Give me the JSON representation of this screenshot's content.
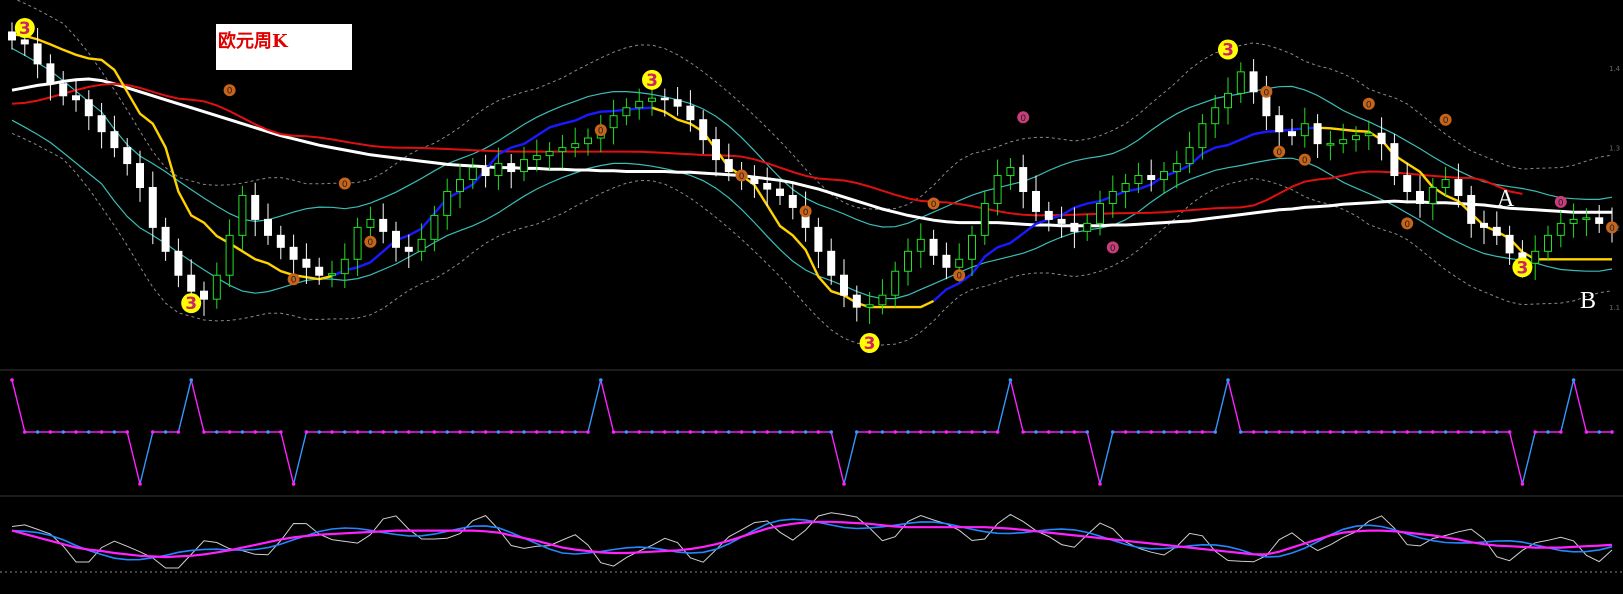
{
  "title": "欧元周K",
  "annotations": {
    "A": "A",
    "B": "B"
  },
  "marker_text": {
    "big": "3",
    "small": "0"
  },
  "colors": {
    "background": "#000000",
    "up_candle": "#22e022",
    "down_candle": "#ffffff",
    "white_ma": "#ffffff",
    "fast_ma_down": "#ffd200",
    "fast_ma_up": "#1a1aff",
    "red_ma": "#e01010",
    "cyan_band": "#3bbdb6",
    "envelope": "#8a8a8a",
    "marker_big_fill": "#ffff00",
    "marker_big_text": "#cc2266",
    "marker_small_fill": "#c8641a",
    "marker_pink_fill": "#c83c78",
    "osc_up": "#3399ff",
    "osc_down": "#ff22ff",
    "stoch_white": "#cfcfcf",
    "stoch_blue": "#2288ff",
    "stoch_magenta": "#ff22ff"
  },
  "chart_data": [
    {
      "type": "candlestick",
      "panel": "price",
      "n": 126,
      "close": [
        1.435,
        1.43,
        1.405,
        1.38,
        1.365,
        1.36,
        1.34,
        1.32,
        1.3,
        1.28,
        1.25,
        1.2,
        1.17,
        1.14,
        1.12,
        1.11,
        1.14,
        1.19,
        1.24,
        1.21,
        1.19,
        1.175,
        1.16,
        1.15,
        1.14,
        1.142,
        1.16,
        1.2,
        1.21,
        1.195,
        1.175,
        1.17,
        1.185,
        1.215,
        1.245,
        1.26,
        1.275,
        1.265,
        1.28,
        1.27,
        1.285,
        1.29,
        1.295,
        1.3,
        1.305,
        1.312,
        1.325,
        1.34,
        1.35,
        1.358,
        1.362,
        1.36,
        1.352,
        1.335,
        1.31,
        1.285,
        1.27,
        1.262,
        1.255,
        1.248,
        1.24,
        1.225,
        1.2,
        1.17,
        1.14,
        1.115,
        1.1,
        1.103,
        1.115,
        1.145,
        1.17,
        1.185,
        1.165,
        1.15,
        1.16,
        1.19,
        1.23,
        1.265,
        1.275,
        1.245,
        1.22,
        1.21,
        1.205,
        1.195,
        1.205,
        1.23,
        1.245,
        1.255,
        1.265,
        1.26,
        1.27,
        1.28,
        1.3,
        1.33,
        1.35,
        1.368,
        1.395,
        1.37,
        1.34,
        1.32,
        1.315,
        1.33,
        1.305,
        1.305,
        1.31,
        1.315,
        1.318,
        1.305,
        1.265,
        1.245,
        1.23,
        1.25,
        1.26,
        1.24,
        1.205,
        1.2,
        1.19,
        1.168,
        1.155,
        1.17,
        1.19,
        1.205,
        1.21,
        1.212,
        1.205,
        1.196
      ],
      "ma_slow": [
        1.372,
        1.375,
        1.378,
        1.38,
        1.383,
        1.385,
        1.386,
        1.384,
        1.38,
        1.375,
        1.37,
        1.365,
        1.36,
        1.355,
        1.35,
        1.345,
        1.34,
        1.335,
        1.33,
        1.325,
        1.32,
        1.315,
        1.311,
        1.307,
        1.303,
        1.3,
        1.297,
        1.294,
        1.291,
        1.289,
        1.287,
        1.285,
        1.283,
        1.281,
        1.279,
        1.278,
        1.277,
        1.276,
        1.275,
        1.275,
        1.274,
        1.274,
        1.273,
        1.273,
        1.272,
        1.272,
        1.271,
        1.271,
        1.27,
        1.27,
        1.27,
        1.27,
        1.269,
        1.269,
        1.268,
        1.267,
        1.266,
        1.265,
        1.263,
        1.261,
        1.259,
        1.256,
        1.252,
        1.248,
        1.243,
        1.238,
        1.233,
        1.228,
        1.223,
        1.219,
        1.215,
        1.212,
        1.209,
        1.207,
        1.206,
        1.206,
        1.206,
        1.206,
        1.205,
        1.204,
        1.203,
        1.203,
        1.202,
        1.202,
        1.202,
        1.202,
        1.203,
        1.203,
        1.204,
        1.205,
        1.206,
        1.207,
        1.208,
        1.21,
        1.212,
        1.214,
        1.216,
        1.218,
        1.22,
        1.222,
        1.223,
        1.225,
        1.226,
        1.227,
        1.229,
        1.23,
        1.231,
        1.232,
        1.233,
        1.232,
        1.232,
        1.231,
        1.231,
        1.23,
        1.229,
        1.228,
        1.226,
        1.224,
        1.223,
        1.222,
        1.221,
        1.22,
        1.219,
        1.219,
        1.219,
        1.219
      ],
      "ytick_labels": [
        "1.4",
        "1.3",
        "1.2",
        "1.1"
      ],
      "fast_ma_knots": [
        [
          0,
          1.442
        ],
        [
          7,
          1.41
        ],
        [
          11,
          1.33
        ],
        [
          14,
          1.215
        ],
        [
          17,
          1.18
        ],
        [
          19,
          1.16
        ],
        [
          22,
          1.14
        ],
        [
          24,
          1.135
        ],
        [
          27,
          1.15
        ],
        [
          31,
          1.19
        ],
        [
          35,
          1.245
        ],
        [
          39,
          1.3
        ],
        [
          43,
          1.33
        ],
        [
          46,
          1.345
        ],
        [
          50,
          1.35
        ],
        [
          53,
          1.33
        ],
        [
          57,
          1.265
        ],
        [
          61,
          1.19
        ],
        [
          64,
          1.12
        ],
        [
          67,
          1.1
        ],
        [
          71,
          1.1
        ],
        [
          74,
          1.13
        ],
        [
          77,
          1.175
        ],
        [
          81,
          1.21
        ],
        [
          84,
          1.23
        ],
        [
          88,
          1.248
        ],
        [
          91,
          1.27
        ],
        [
          94,
          1.3
        ],
        [
          98,
          1.32
        ],
        [
          102,
          1.325
        ],
        [
          106,
          1.32
        ],
        [
          109,
          1.28
        ],
        [
          112,
          1.24
        ],
        [
          116,
          1.195
        ],
        [
          119,
          1.16
        ],
        [
          123,
          1.16
        ],
        [
          125,
          1.16
        ]
      ],
      "fast_ma_down_ranges": [
        [
          0,
          24
        ],
        [
          50,
          71
        ],
        [
          102,
          125
        ]
      ],
      "red_ma_knots": [
        [
          0,
          1.355
        ],
        [
          8,
          1.38
        ],
        [
          14,
          1.36
        ],
        [
          22,
          1.315
        ],
        [
          30,
          1.3
        ],
        [
          40,
          1.295
        ],
        [
          48,
          1.295
        ],
        [
          56,
          1.29
        ],
        [
          64,
          1.26
        ],
        [
          72,
          1.232
        ],
        [
          80,
          1.215
        ],
        [
          88,
          1.218
        ],
        [
          96,
          1.225
        ],
        [
          102,
          1.26
        ],
        [
          106,
          1.27
        ],
        [
          114,
          1.262
        ],
        [
          118,
          1.242
        ]
      ],
      "big_markers": [
        {
          "i": 1,
          "y": 1.45
        },
        {
          "i": 14,
          "y": 1.105
        },
        {
          "i": 50,
          "y": 1.385
        },
        {
          "i": 67,
          "y": 1.055
        },
        {
          "i": 95,
          "y": 1.423
        },
        {
          "i": 118,
          "y": 1.15
        }
      ],
      "small_markers": [
        {
          "i": 17,
          "y": 1.372,
          "c": "o"
        },
        {
          "i": 22,
          "y": 1.135,
          "c": "o"
        },
        {
          "i": 26,
          "y": 1.255,
          "c": "o"
        },
        {
          "i": 28,
          "y": 1.182,
          "c": "o"
        },
        {
          "i": 46,
          "y": 1.322,
          "c": "o"
        },
        {
          "i": 57,
          "y": 1.265,
          "c": "o"
        },
        {
          "i": 62,
          "y": 1.22,
          "c": "o"
        },
        {
          "i": 72,
          "y": 1.23,
          "c": "o"
        },
        {
          "i": 74,
          "y": 1.14,
          "c": "o"
        },
        {
          "i": 79,
          "y": 1.338,
          "c": "p"
        },
        {
          "i": 86,
          "y": 1.175,
          "c": "p"
        },
        {
          "i": 98,
          "y": 1.37,
          "c": "o"
        },
        {
          "i": 99,
          "y": 1.295,
          "c": "o"
        },
        {
          "i": 101,
          "y": 1.285,
          "c": "o"
        },
        {
          "i": 106,
          "y": 1.355,
          "c": "o"
        },
        {
          "i": 109,
          "y": 1.205,
          "c": "o"
        },
        {
          "i": 112,
          "y": 1.335,
          "c": "o"
        },
        {
          "i": 121,
          "y": 1.232,
          "c": "p"
        },
        {
          "i": 125,
          "y": 1.2,
          "c": "o"
        }
      ]
    },
    {
      "type": "line",
      "panel": "oscillator",
      "pattern": [
        "flat-neg",
        "flat-pos"
      ],
      "ylim": [
        -1,
        1
      ],
      "peaks": [
        0,
        14,
        46,
        78,
        95,
        122
      ],
      "troughs": [
        10,
        22,
        65,
        85,
        118
      ]
    },
    {
      "type": "line",
      "panel": "stochastic",
      "series": [
        "white",
        "blue",
        "magenta"
      ],
      "ylim": [
        0,
        100
      ],
      "magenta": [
        55,
        50,
        45,
        40,
        35,
        30,
        27,
        25,
        22,
        20,
        18,
        17,
        16,
        17,
        18,
        20,
        23,
        26,
        30,
        34,
        38,
        42,
        45,
        47,
        49,
        50,
        51,
        52,
        53,
        54,
        55,
        55,
        55,
        55,
        55,
        55,
        55,
        54,
        52,
        48,
        44,
        40,
        35,
        30,
        27,
        25,
        23,
        22,
        22,
        23,
        24,
        25,
        26,
        28,
        31,
        35,
        40,
        46,
        52,
        58,
        62,
        65,
        67,
        68,
        68,
        67,
        66,
        65,
        63,
        61,
        60,
        60,
        60,
        60,
        60,
        60,
        60,
        59,
        58,
        56,
        54,
        52,
        50,
        48,
        46,
        44,
        42,
        40,
        38,
        36,
        34,
        32,
        30,
        28,
        26,
        24,
        22,
        20,
        20,
        24,
        30,
        36,
        42,
        48,
        52,
        54,
        55,
        55,
        54,
        52,
        50,
        48,
        45,
        42,
        38,
        35,
        33,
        32,
        31,
        30,
        30,
        30,
        31,
        32,
        33,
        34
      ]
    }
  ]
}
